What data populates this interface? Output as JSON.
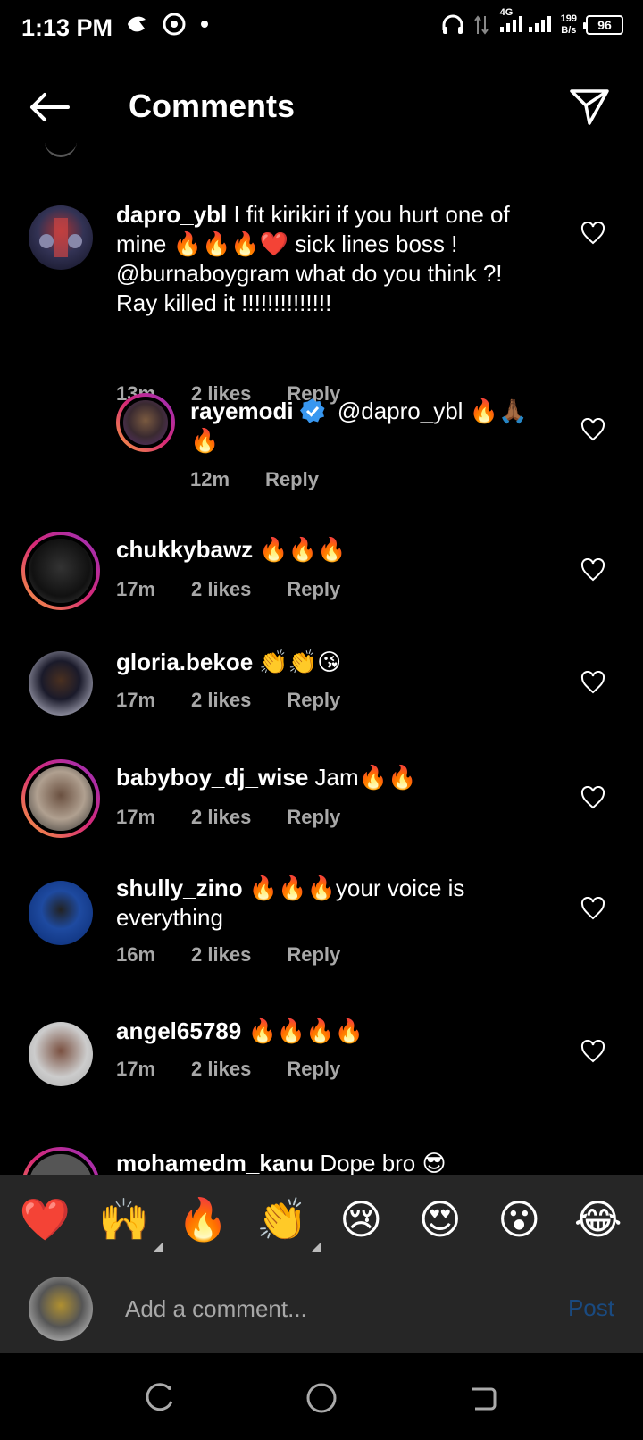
{
  "status_bar": {
    "time": "1:13 PM",
    "network": "4G",
    "speed_value": "199",
    "speed_unit": "B/s",
    "battery": "96"
  },
  "header": {
    "title": "Comments"
  },
  "comments": [
    {
      "username": "dapro_ybl",
      "text": "I fit kirikiri if you hurt one of mine 🔥🔥🔥❤️ sick lines boss ! @burnaboygram what do you think ?! Ray killed it !!!!!!!!!!!!!!",
      "time": "13m",
      "likes": "2 likes",
      "reply": "Reply"
    },
    {
      "username": "rayemodi",
      "verified": true,
      "mention": "@dapro_ybl",
      "text": "🔥🙏🏾🔥",
      "time": "12m",
      "reply": "Reply"
    },
    {
      "username": "chukkybawz",
      "text": "🔥🔥🔥",
      "time": "17m",
      "likes": "2 likes",
      "reply": "Reply"
    },
    {
      "username": "gloria.bekoe",
      "text": "👏👏😘",
      "time": "17m",
      "likes": "2 likes",
      "reply": "Reply"
    },
    {
      "username": "babyboy_dj_wise",
      "text": "Jam🔥🔥",
      "time": "17m",
      "likes": "2 likes",
      "reply": "Reply"
    },
    {
      "username": "shully_zino",
      "text": "🔥🔥🔥your voice is everything",
      "time": "16m",
      "likes": "2 likes",
      "reply": "Reply"
    },
    {
      "username": "angel65789",
      "text": "🔥🔥🔥🔥",
      "time": "17m",
      "likes": "2 likes",
      "reply": "Reply"
    },
    {
      "username": "mohamedm_kanu",
      "text": "Dope bro 😎"
    }
  ],
  "emoji_bar": [
    "❤️",
    "🙌",
    "🔥",
    "👏",
    "😢",
    "😍",
    "😮",
    "😂"
  ],
  "composer": {
    "placeholder": "Add a comment...",
    "post_label": "Post"
  },
  "colors": {
    "background": "#000000",
    "secondary_text": "#a8a8a8",
    "composer_bg": "#262626",
    "post_disabled": "#1a4a80",
    "verified": "#3897f0"
  }
}
